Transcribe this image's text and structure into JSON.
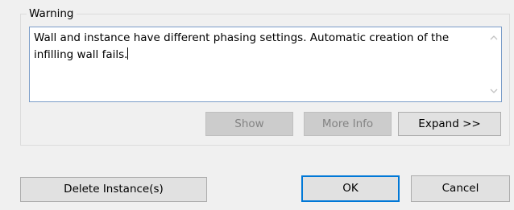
{
  "dialog": {
    "group_title": "Warning",
    "message": "Wall and instance have different phasing settings. Automatic creation of the infilling wall fails.",
    "buttons": {
      "show": "Show",
      "more_info": "More Info",
      "expand": "Expand >>",
      "delete_instances": "Delete Instance(s)",
      "ok": "OK",
      "cancel": "Cancel"
    }
  },
  "colors": {
    "dialog_bg": "#f0f0f0",
    "accent": "#0078d7",
    "disabled_text": "#838383"
  }
}
